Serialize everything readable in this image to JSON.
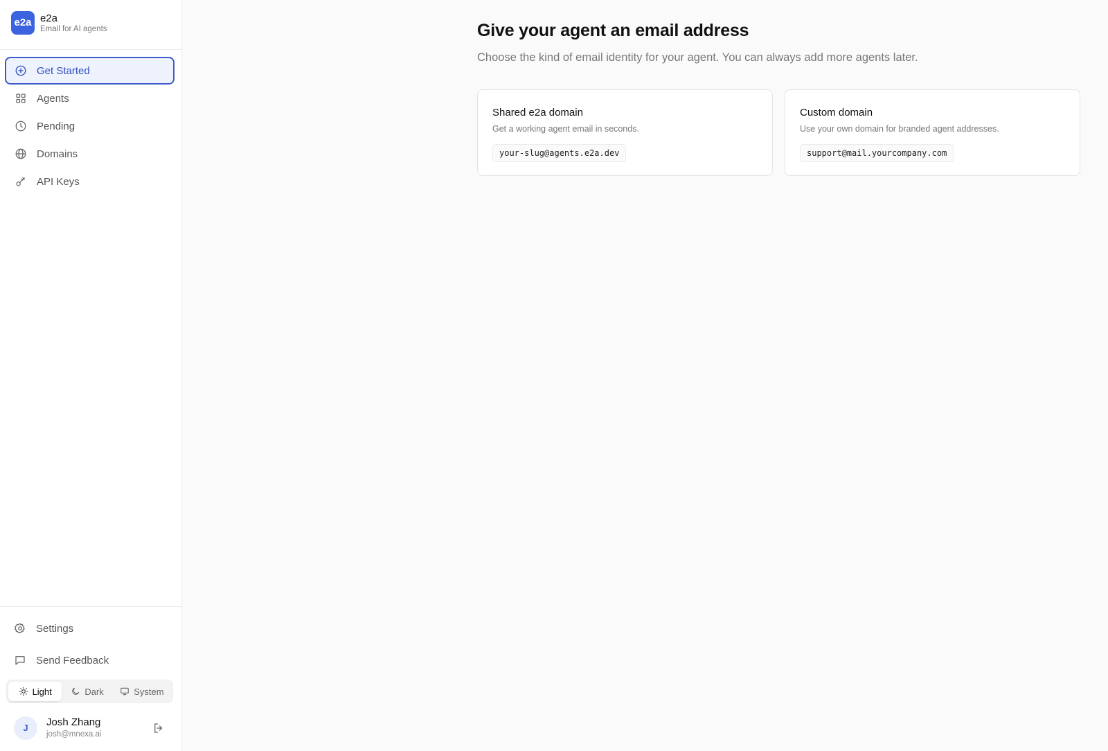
{
  "brand": {
    "logo_text": "e2a",
    "name": "e2a",
    "tagline": "Email for AI agents"
  },
  "nav": {
    "items": [
      {
        "label": "Get Started",
        "icon": "plus-circle-icon",
        "active": true
      },
      {
        "label": "Agents",
        "icon": "grid-icon"
      },
      {
        "label": "Pending",
        "icon": "clock-icon"
      },
      {
        "label": "Domains",
        "icon": "globe-icon"
      },
      {
        "label": "API Keys",
        "icon": "key-icon"
      }
    ]
  },
  "bottom": {
    "settings_label": "Settings",
    "feedback_label": "Send Feedback"
  },
  "theme": {
    "options": [
      {
        "label": "Light",
        "icon": "sun-icon",
        "active": true
      },
      {
        "label": "Dark",
        "icon": "moon-icon"
      },
      {
        "label": "System",
        "icon": "monitor-icon"
      }
    ]
  },
  "user": {
    "initial": "J",
    "name": "Josh Zhang",
    "email": "josh@mnexa.ai"
  },
  "main": {
    "title": "Give your agent an email address",
    "subtitle": "Choose the kind of email identity for your agent. You can always add more agents later.",
    "cards": [
      {
        "title": "Shared e2a domain",
        "description": "Get a working agent email in seconds.",
        "example": "your-slug@agents.e2a.dev"
      },
      {
        "title": "Custom domain",
        "description": "Use your own domain for branded agent addresses.",
        "example": "support@mail.yourcompany.com"
      }
    ]
  },
  "colors": {
    "accent": "#3b5bcc",
    "logo_bg": "#3b63e0",
    "background": "#fafafa"
  }
}
